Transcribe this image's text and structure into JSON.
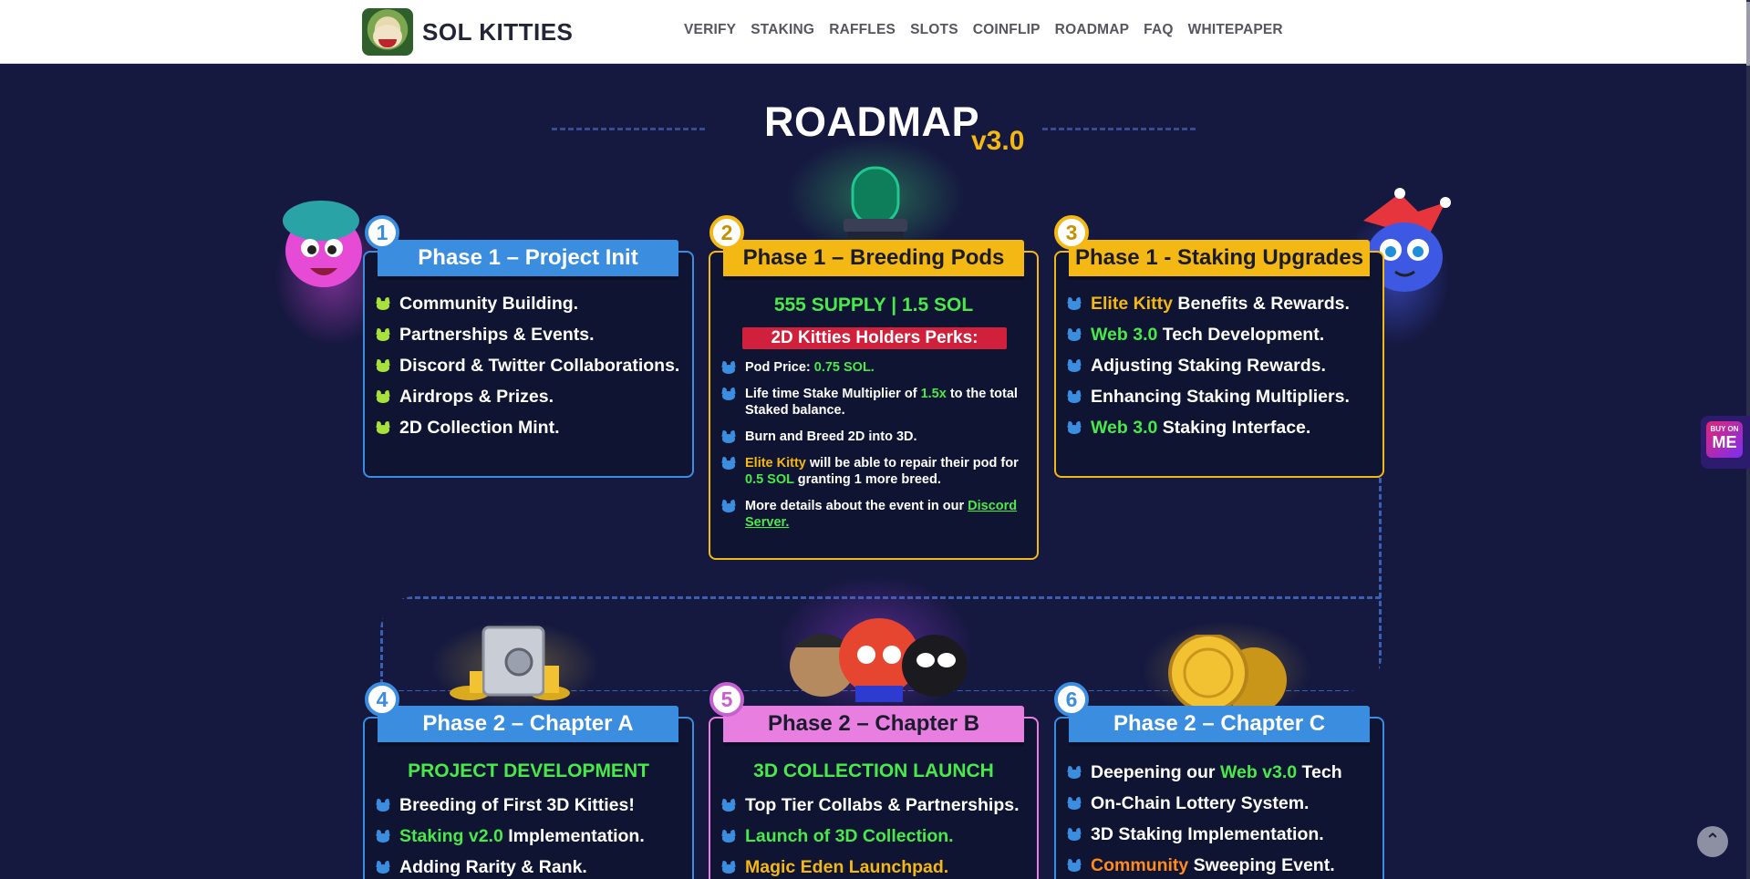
{
  "header": {
    "logo_text": "SOL KITTIES",
    "nav": [
      "VERIFY",
      "STAKING",
      "RAFFLES",
      "SLOTS",
      "COINFLIP",
      "ROADMAP",
      "FAQ",
      "WHITEPAPER"
    ]
  },
  "roadmap": {
    "title": "ROADMAP",
    "version": "v3.0"
  },
  "colors": {
    "background": "#15183f",
    "card_bg": "#0f1433",
    "blue": "#3b8de0",
    "gold": "#f4b814",
    "pink": "#e87fe0",
    "green": "#48e94b",
    "red": "#d0203b"
  },
  "cards": [
    {
      "number": "1",
      "title": "Phase 1 – Project Init",
      "items": [
        {
          "pre": "",
          "hl": "",
          "post": "Community Building."
        },
        {
          "pre": "",
          "hl": "",
          "post": "Partnerships & Events."
        },
        {
          "pre": "",
          "hl": "",
          "post": "Discord & Twitter Collaborations."
        },
        {
          "pre": "",
          "hl": "",
          "post": "Airdrops & Prizes."
        },
        {
          "pre": "",
          "hl": "",
          "post": "2D Collection Mint."
        }
      ]
    },
    {
      "number": "2",
      "title": "Phase 1 – Breeding Pods",
      "subtitle": "555 SUPPLY | 1.5 SOL",
      "banner": "2D Kitties Holders Perks:",
      "items": [
        {
          "a": "Pod Price: ",
          "b": "0.75 SOL.",
          "c": ""
        },
        {
          "a": "Life time Stake Multiplier of ",
          "b": "1.5x",
          "c": " to the total Staked balance."
        },
        {
          "a": "Burn and Breed 2D into 3D.",
          "b": "",
          "c": ""
        },
        {
          "a": "Elite Kitty",
          "b": " will be able to repair their pod for ",
          "c": "0.5 SOL",
          "d": " granting 1 more breed."
        },
        {
          "a": "More details about the event in our ",
          "b": "Discord Server.",
          "c": ""
        }
      ]
    },
    {
      "number": "3",
      "title": "Phase 1 - Staking Upgrades",
      "items": [
        {
          "hl": "Elite Kitty",
          "post": " Benefits & Rewards."
        },
        {
          "hl": "Web 3.0",
          "post": " Tech Development."
        },
        {
          "hl": "",
          "post": "Adjusting Staking Rewards."
        },
        {
          "hl": "",
          "post": "Enhancing Staking Multipliers."
        },
        {
          "hl": "Web 3.0",
          "post": " Staking Interface."
        }
      ]
    },
    {
      "number": "4",
      "title": "Phase 2 – Chapter A",
      "subtitle": "PROJECT DEVELOPMENT",
      "items": [
        {
          "hl": "",
          "post": "Breeding of First 3D Kitties!"
        },
        {
          "hl": "Staking v2.0",
          "post": " Implementation."
        },
        {
          "hl": "",
          "post": "Adding Rarity & Rank."
        }
      ]
    },
    {
      "number": "5",
      "title": "Phase 2 – Chapter B",
      "subtitle": "3D COLLECTION LAUNCH",
      "items": [
        {
          "hl": "",
          "post": "Top Tier Collabs & Partnerships."
        },
        {
          "hl": "Launch of 3D Collection.",
          "post": ""
        },
        {
          "hl": "Magic Eden Launchpad.",
          "post": ""
        }
      ]
    },
    {
      "number": "6",
      "title": "Phase 2 – Chapter C",
      "items": [
        {
          "pre": "Deepening our ",
          "hl": "Web v3.0",
          "post": " Tech"
        },
        {
          "pre": "On-Chain Lottery System.",
          "hl": "",
          "post": ""
        },
        {
          "pre": "3D Staking Implementation.",
          "hl": "",
          "post": ""
        },
        {
          "pre": "",
          "hl": "Community",
          "post": " Sweeping Event."
        }
      ]
    }
  ],
  "side_widgets": {
    "buy_label": "BUY ON",
    "buy_logo": "ME"
  }
}
